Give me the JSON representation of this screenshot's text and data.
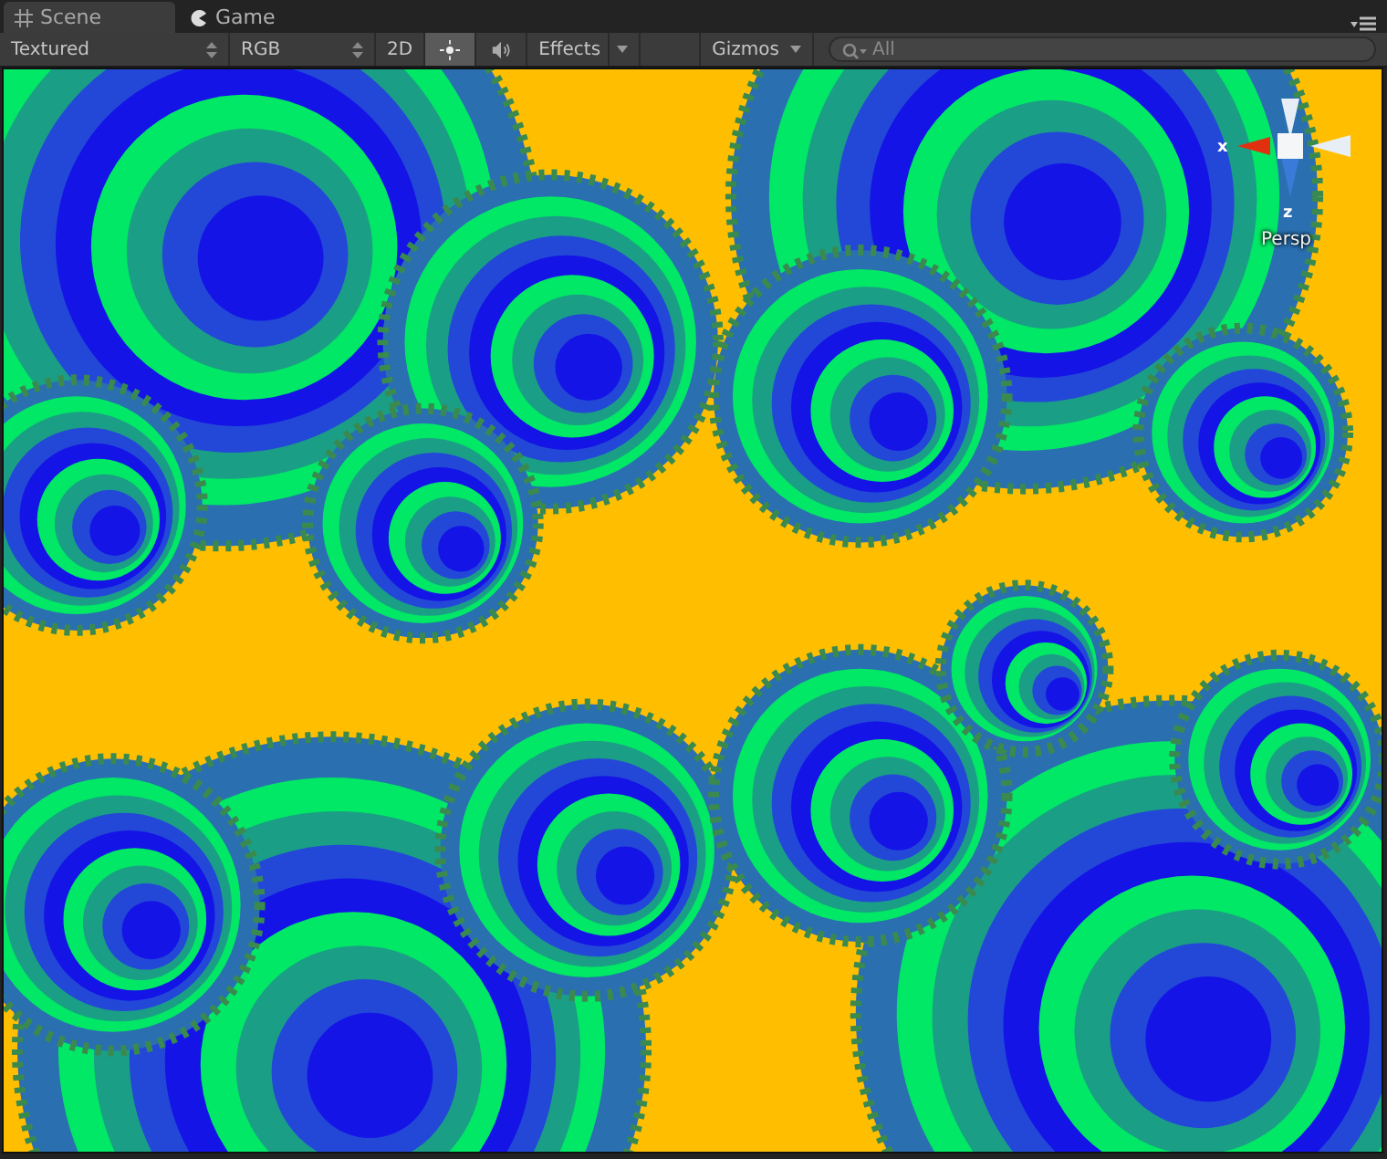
{
  "tabs": [
    {
      "label": "Scene",
      "selected": true,
      "kind": "grid"
    },
    {
      "label": "Game",
      "selected": false,
      "kind": "pacman"
    }
  ],
  "toolbar": {
    "draw_mode": "Textured",
    "render_mode": "RGB",
    "mode_2d": {
      "label": "2D",
      "on": false
    },
    "lighting_on": true,
    "audio_on": false,
    "effects": "Effects",
    "gizmos": "Gizmos",
    "search": {
      "placeholder": "All"
    }
  },
  "gizmo": {
    "x_label": "x",
    "z_label": "z",
    "projection": "Persp"
  }
}
